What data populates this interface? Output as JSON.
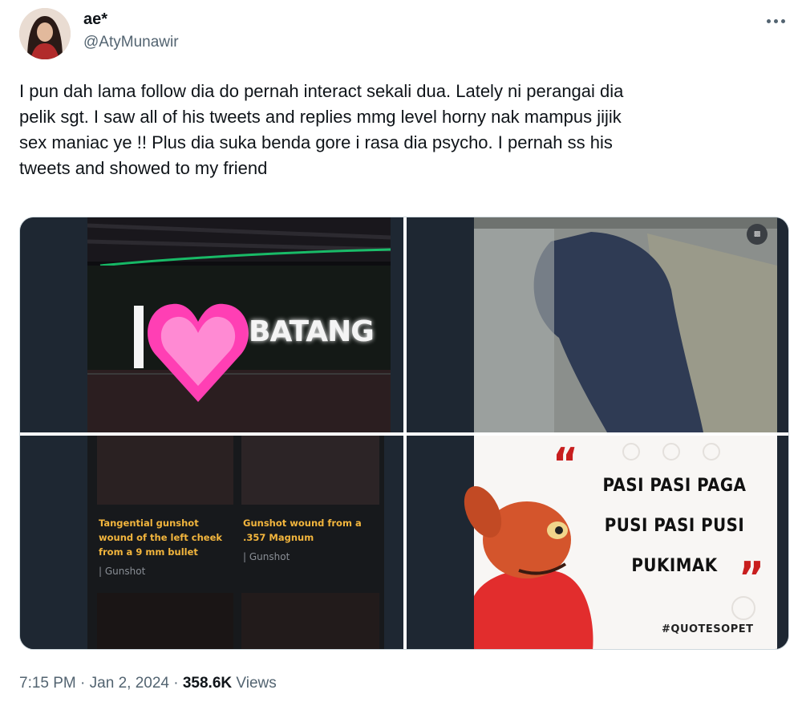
{
  "user": {
    "display_name": "ae*",
    "handle": "@AtyMunawir",
    "avatar_icon": "profile-photo"
  },
  "more_icon": "more-horizontal-icon",
  "tweet": {
    "text": "I pun dah lama follow dia do pernah interact sekali dua. Lately ni perangai dia\npelik sgt. I saw all of his tweets and replies mmg level horny nak mampus jijik\nsex maniac ye !! Plus dia suka benda gore i rasa dia psycho. I pernah ss his\ntweets and showed to my friend"
  },
  "media": {
    "image1": {
      "sign_left": "I",
      "sign_right": "BATANG"
    },
    "image2": {
      "badge": "gif-badge"
    },
    "image3": {
      "card1_title": "Tangential gunshot wound of the left cheek from a 9 mm bullet",
      "card1_tag": "| Gunshot",
      "card2_title": "Gunshot wound from a .357 Magnum",
      "card2_tag": "| Gunshot"
    },
    "image4": {
      "line1": "PASI PASI PAGA",
      "line2": "PUSI PASI PUSI",
      "line3": "PUKIMAK",
      "hashtag": "#QUOTESOPET",
      "open_quote": "“",
      "close_quote": "”"
    }
  },
  "footer": {
    "time": "7:15 PM",
    "sep1": " · ",
    "date": "Jan 2, 2024",
    "sep2": " · ",
    "views_count": "358.6K",
    "views_label": " Views"
  },
  "colors": {
    "text": "#0f1419",
    "secondary": "#536471",
    "neon_pink": "#ff3fb4",
    "gold": "#f2b53d",
    "quote_red": "#c81e1e"
  }
}
